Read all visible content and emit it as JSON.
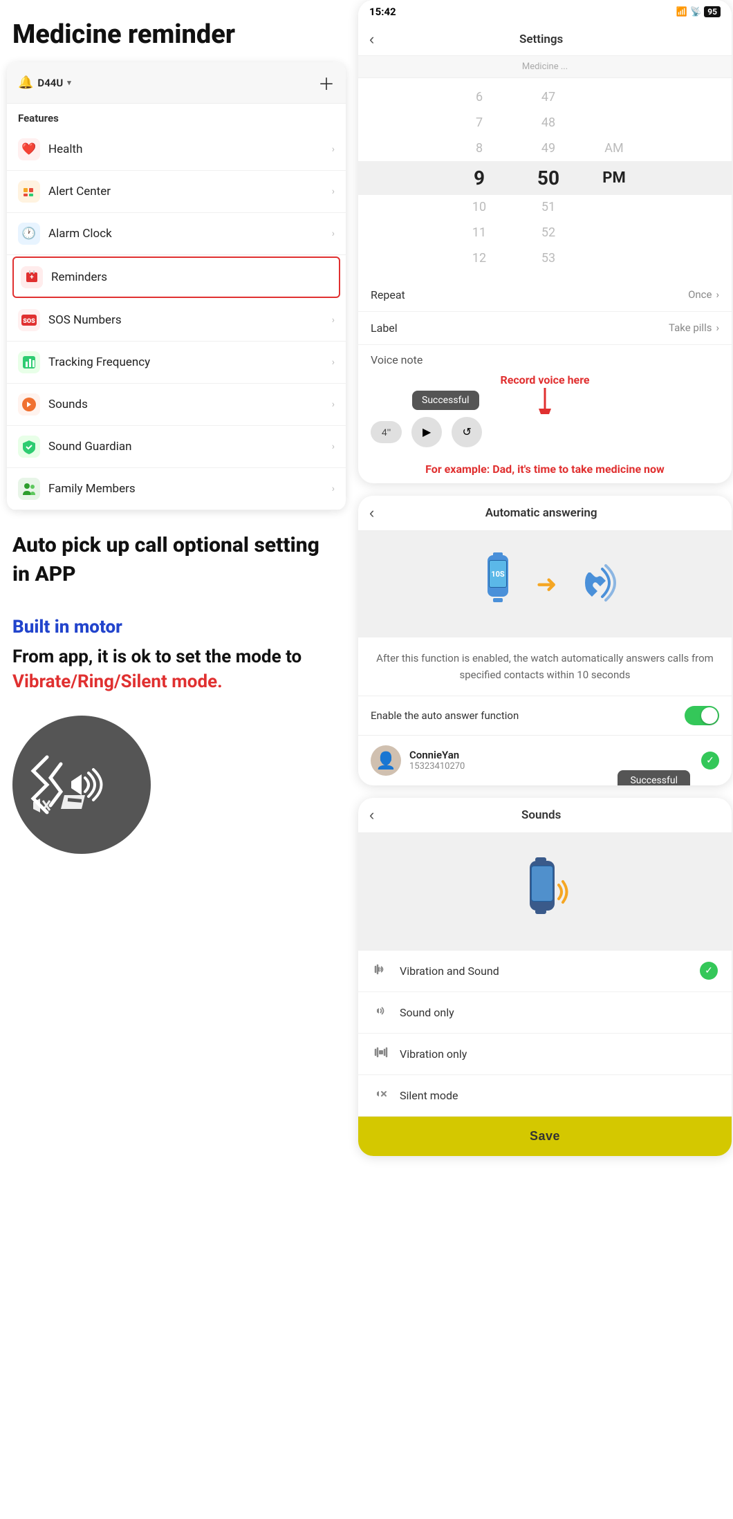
{
  "page": {
    "title": "Medicine reminder"
  },
  "left": {
    "device_name": "D44U",
    "features_label": "Features",
    "menu_items": [
      {
        "id": "health",
        "label": "Health",
        "icon": "❤️",
        "icon_class": "icon-health"
      },
      {
        "id": "alert",
        "label": "Alert Center",
        "icon": "🟠",
        "icon_class": "icon-alert"
      },
      {
        "id": "alarm",
        "label": "Alarm Clock",
        "icon": "🕐",
        "icon_class": "icon-alarm"
      },
      {
        "id": "reminders",
        "label": "Reminders",
        "icon": "➕",
        "icon_class": "icon-reminder",
        "active": true
      },
      {
        "id": "sos",
        "label": "SOS Numbers",
        "icon": "🆘",
        "icon_class": "icon-sos"
      },
      {
        "id": "tracking",
        "label": "Tracking Frequency",
        "icon": "📡",
        "icon_class": "icon-tracking"
      },
      {
        "id": "sounds",
        "label": "Sounds",
        "icon": "🔔",
        "icon_class": "icon-sounds"
      },
      {
        "id": "soundguardian",
        "label": "Sound Guardian",
        "icon": "🛡️",
        "icon_class": "icon-soundguardian"
      },
      {
        "id": "family",
        "label": "Family Members",
        "icon": "👥",
        "icon_class": "icon-family"
      }
    ],
    "auto_pick_title": "Auto pick up call optional setting in APP",
    "built_in_label": "Built in motor",
    "built_in_desc_1": "From app, it is ok to set the mode to",
    "built_in_desc_2": "Vibrate/Ring/Silent mode."
  },
  "right": {
    "status_time": "15:42",
    "battery": "95",
    "screen1": {
      "title": "Settings",
      "time_picker": {
        "rows_above": [
          {
            "hour": "6",
            "min": "47"
          },
          {
            "hour": "7",
            "min": "48"
          },
          {
            "hour": "8",
            "min": "49",
            "ampm": "AM"
          }
        ],
        "selected": {
          "hour": "9",
          "min": "50",
          "ampm": "PM"
        },
        "rows_below": [
          {
            "hour": "10",
            "min": "51"
          },
          {
            "hour": "11",
            "min": "52"
          },
          {
            "hour": "12",
            "min": "53"
          }
        ]
      },
      "repeat_label": "Repeat",
      "repeat_value": "Once",
      "label_label": "Label",
      "label_value": "Take pills",
      "voice_note_label": "Voice note",
      "voice_duration": "4''",
      "toast_text": "Successful",
      "record_voice_annotation": "Record voice here",
      "example_annotation": "For example: Dad, it's time to take medicine now"
    },
    "screen2": {
      "title": "Automatic answering",
      "description": "After this function is enabled, the watch automatically answers calls from specified contacts within 10 seconds",
      "enable_label": "Enable the auto answer function",
      "contact_name": "ConnieYan",
      "contact_phone": "15323410270",
      "toast_text": "Successful"
    },
    "screen3": {
      "title": "Sounds",
      "options": [
        {
          "id": "vib_sound",
          "label": "Vibration and Sound",
          "icon": "🔔",
          "selected": true
        },
        {
          "id": "sound_only",
          "label": "Sound only",
          "icon": "🔊",
          "selected": false
        },
        {
          "id": "vib_only",
          "label": "Vibration only",
          "icon": "📳",
          "selected": false
        },
        {
          "id": "silent",
          "label": "Silent mode",
          "icon": "🔇",
          "selected": false
        }
      ],
      "save_label": "Save"
    }
  }
}
